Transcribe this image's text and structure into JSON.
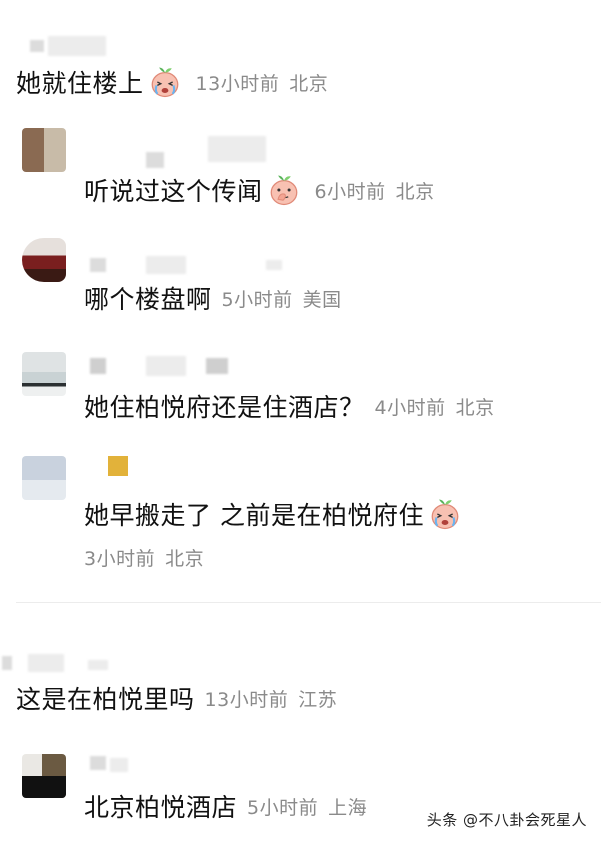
{
  "comments": [
    {
      "text": "她就住楼上",
      "emoji": "crying-face-icon",
      "time": "13小时前",
      "location": "北京"
    },
    {
      "text": "听说过这个传闻",
      "emoji": "thinking-face-icon",
      "time": "6小时前",
      "location": "北京"
    },
    {
      "text": "哪个楼盘啊",
      "emoji": "",
      "time": "5小时前",
      "location": "美国"
    },
    {
      "text": "她住柏悦府还是住酒店？",
      "emoji": "",
      "time": "4小时前",
      "location": "北京"
    },
    {
      "text": "她早搬走了 之前是在柏悦府住",
      "emoji": "crying-face-icon",
      "time": "3小时前",
      "location": "北京"
    },
    {
      "text": "这是在柏悦里吗",
      "emoji": "",
      "time": "13小时前",
      "location": "江苏"
    },
    {
      "text": "北京柏悦酒店",
      "emoji": "",
      "time": "5小时前",
      "location": "上海"
    }
  ],
  "watermark": "头条 @不八卦会死星人",
  "colors": {
    "text": "#111111",
    "meta": "#8a8a8a",
    "background": "#ffffff",
    "emoji_face": "#f7b8a8",
    "emoji_leaf": "#59b35a"
  }
}
